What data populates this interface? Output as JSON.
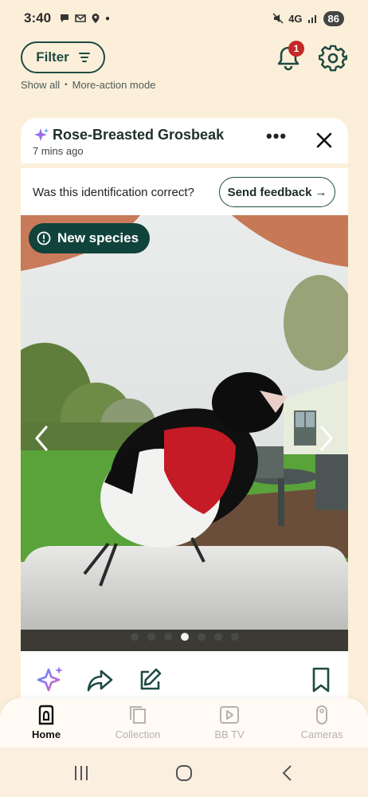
{
  "status_bar": {
    "time": "3:40",
    "network": "4G",
    "battery": "86"
  },
  "top": {
    "filter_label": "Filter",
    "show_all": "Show all",
    "more_action_mode": "More-action mode",
    "notification_count": "1"
  },
  "card": {
    "title": "Rose-Breasted Grosbeak",
    "time_ago": "7 mins ago",
    "more_label": "•••",
    "feedback_question": "Was this identification correct?",
    "feedback_button": "Send feedback",
    "feedback_arrow": "→",
    "badge": "New species",
    "carousel": {
      "count": 7,
      "active_index": 3
    }
  },
  "bottom_nav": {
    "items": [
      {
        "label": "Home",
        "icon": "home-icon",
        "active": true
      },
      {
        "label": "Collection",
        "icon": "collection-icon",
        "active": false
      },
      {
        "label": "BB TV",
        "icon": "tv-icon",
        "active": false
      },
      {
        "label": "Cameras",
        "icon": "camera-icon",
        "active": false
      }
    ]
  },
  "colors": {
    "background": "#fcefd9",
    "primary": "#1d4b43",
    "badge_bg": "#10433b",
    "notification": "#c62828",
    "sparkle": "#9b6cf2"
  }
}
